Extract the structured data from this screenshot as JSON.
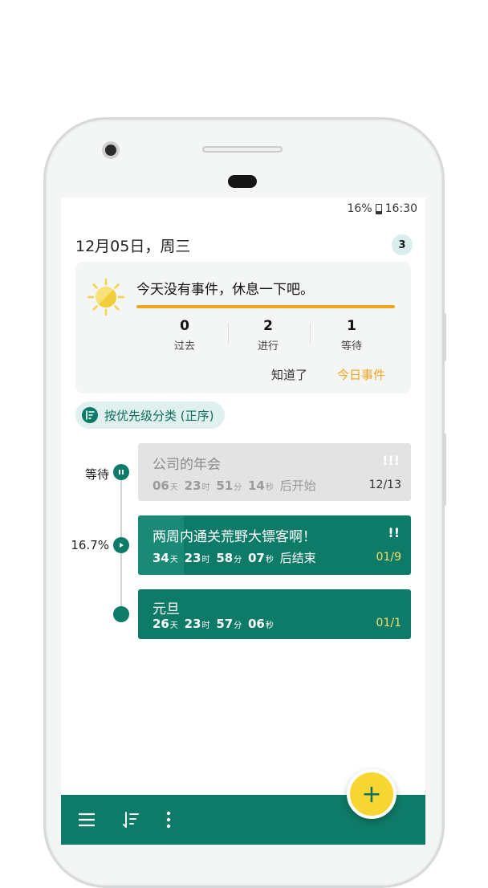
{
  "status_bar": {
    "battery": "16%",
    "time": "16:30"
  },
  "header": {
    "date": "12月05日，周三",
    "badge_count": "3"
  },
  "summary": {
    "message": "今天没有事件，休息一下吧。",
    "stats": [
      {
        "value": "0",
        "label": "过去"
      },
      {
        "value": "2",
        "label": "进行"
      },
      {
        "value": "1",
        "label": "等待"
      }
    ],
    "ack_label": "知道了",
    "today_label": "今日事件",
    "accent_color": "#f2a41e"
  },
  "sort_chip": {
    "label": "按优先级分类 (正序)"
  },
  "timeline": {
    "labels": {
      "waiting": "等待",
      "progress": "16.7%"
    },
    "progress_fraction": 0.167
  },
  "events": [
    {
      "title": "公司的年会",
      "priority": "!!!",
      "days": "06",
      "hours": "23",
      "minutes": "51",
      "seconds": "14",
      "suffix": "后开始",
      "date": "12/13",
      "state": "waiting"
    },
    {
      "title": "两周内通关荒野大镖客啊！",
      "priority": "!!",
      "days": "34",
      "hours": "23",
      "minutes": "58",
      "seconds": "07",
      "suffix": "后结束",
      "date": "01/9",
      "state": "in-progress"
    },
    {
      "title": "元旦",
      "priority": "",
      "days": "26",
      "hours": "23",
      "minutes": "57",
      "seconds": "06",
      "suffix": "",
      "date": "01/1",
      "state": "normal"
    }
  ],
  "units": {
    "day": "天",
    "hour": "时",
    "minute": "分",
    "second": "秒"
  },
  "bottom_bar": {
    "fab": "+"
  },
  "colors": {
    "primary": "#0e7a68",
    "fab": "#f7d533",
    "highlight": "#f7e06a"
  }
}
